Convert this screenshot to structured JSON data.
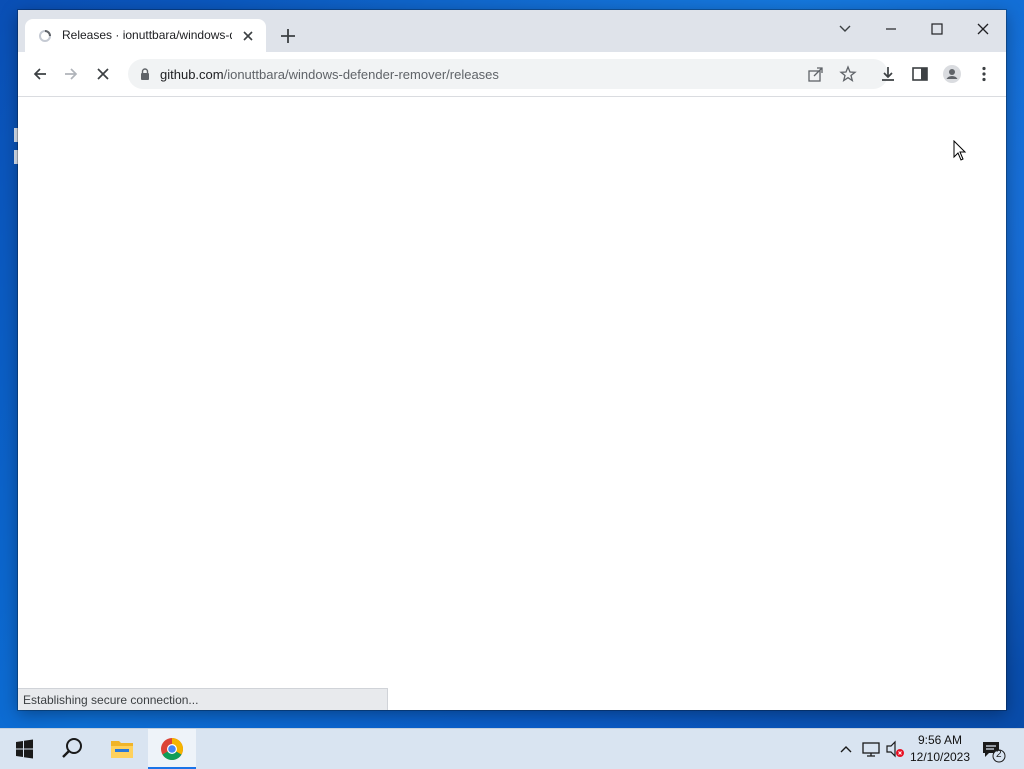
{
  "browser": {
    "tab": {
      "title": "Releases · ionuttbara/windows-defender-remover",
      "close_icon": "close-icon",
      "favicon": "loading-spinner-icon"
    },
    "new_tab_icon": "plus-icon",
    "window_controls": [
      "chevron-down-icon",
      "minimize-icon",
      "maximize-icon",
      "close-icon"
    ],
    "toolbar": {
      "back_icon": "arrow-left-icon",
      "forward_icon": "arrow-right-icon",
      "stop_icon": "close-icon",
      "url_host": "github.com",
      "url_path": "/ionuttbara/windows-defender-remover/releases",
      "share_icon": "share-icon",
      "bookmark_icon": "star-icon",
      "download_icon": "download-icon",
      "side_panel_icon": "side-panel-icon",
      "profile_icon": "account-icon",
      "menu_icon": "more-vert-icon"
    },
    "status_text": "Establishing secure connection..."
  },
  "taskbar": {
    "start_icon": "windows-logo-icon",
    "search_icon": "search-icon",
    "explorer_icon": "folder-icon",
    "chrome_icon": "chrome-icon",
    "tray": {
      "overflow_icon": "chevron-up-icon",
      "network_icon": "network-icon",
      "volume_icon": "volume-muted-icon"
    },
    "time": "9:56 AM",
    "date": "12/10/2023",
    "notification_count": "2"
  },
  "colors": {
    "accent": "#1a73e8",
    "tabstrip": "#dfe3ea",
    "taskbar": "#d9e4f1",
    "desktop": "#0d6fd6"
  }
}
